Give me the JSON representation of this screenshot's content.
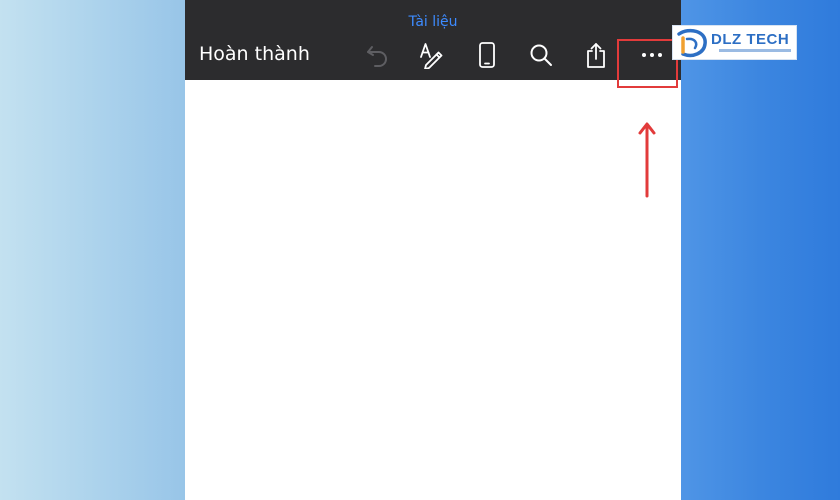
{
  "document": {
    "title": "Tài liệu"
  },
  "toolbar": {
    "done_label": "Hoàn thành",
    "tools": [
      {
        "icon": "undo-icon",
        "enabled": false
      },
      {
        "icon": "markup-pen-icon",
        "enabled": true
      },
      {
        "icon": "phone-view-icon",
        "enabled": true
      },
      {
        "icon": "search-icon",
        "enabled": true
      },
      {
        "icon": "share-icon",
        "enabled": true
      },
      {
        "icon": "more-options-icon",
        "enabled": true
      }
    ]
  },
  "annotation": {
    "highlight_color": "#e23b3b",
    "target": "more-options-icon"
  },
  "logo": {
    "text": "DLZ TECH",
    "brand_color": "#2d6fc4"
  },
  "colors": {
    "toolbar_bg": "#2c2c2e",
    "title_accent": "#3d8bff",
    "done_text": "#ffffff"
  }
}
